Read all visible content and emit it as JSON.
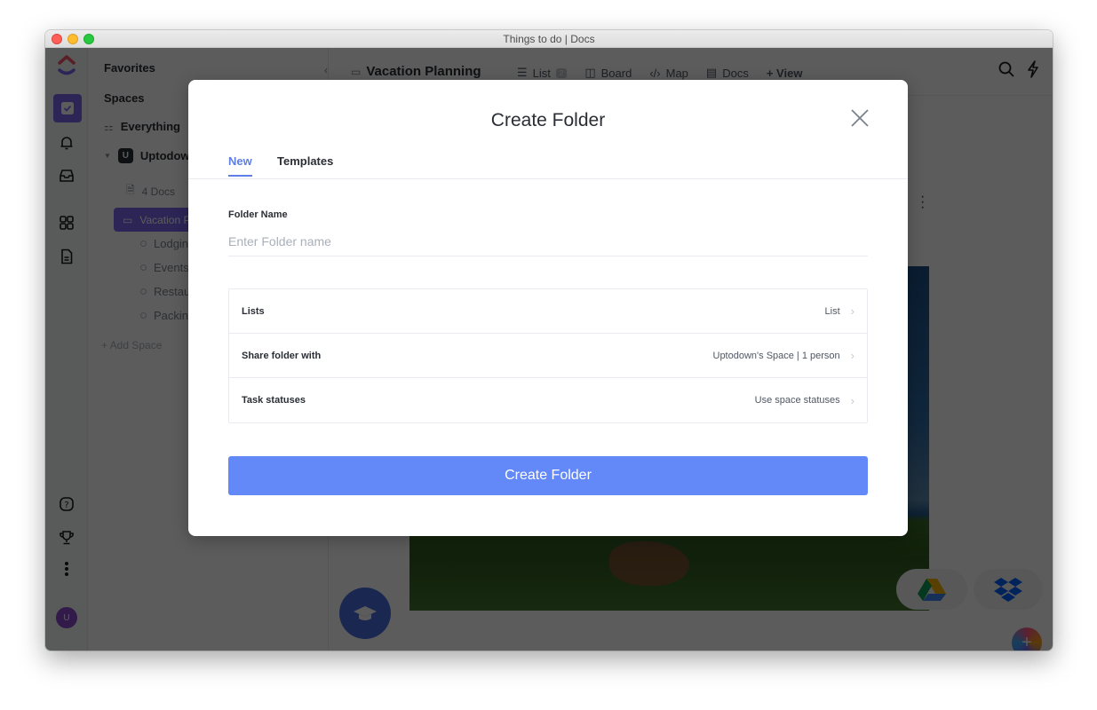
{
  "window": {
    "title": "Things to do | Docs"
  },
  "rail": {
    "icons": [
      "clickup-logo-icon",
      "tasks-icon",
      "notifications-bell-icon",
      "inbox-icon",
      "dashboards-icon",
      "docs-icon",
      "help-icon",
      "trophy-icon",
      "more-icon"
    ],
    "avatar_initial": "U"
  },
  "sidebar": {
    "favorites_label": "Favorites",
    "spaces_label": "Spaces",
    "everything_label": "Everything",
    "space": {
      "initial": "U",
      "name": "Uptodown's Space"
    },
    "docs_label": "4 Docs",
    "active_folder": "Vacation Planning",
    "lists": [
      "Lodging",
      "Events",
      "Restaurants",
      "Packing"
    ],
    "add_space_label": "+ Add Space"
  },
  "topbar": {
    "breadcrumb": "Vacation Planning",
    "views": [
      {
        "label": "List",
        "badge": "2"
      },
      {
        "label": "Board"
      },
      {
        "label": "Map"
      },
      {
        "label": "Docs"
      },
      {
        "label": "+ View"
      }
    ]
  },
  "modal": {
    "title": "Create Folder",
    "tabs": [
      {
        "label": "New",
        "active": true
      },
      {
        "label": "Templates",
        "active": false
      }
    ],
    "folder_name": {
      "label": "Folder Name",
      "value": "",
      "placeholder": "Enter Folder name"
    },
    "options": [
      {
        "label": "Lists",
        "value": "List"
      },
      {
        "label": "Share folder with",
        "value": "Uptodown's Space | 1 person"
      },
      {
        "label": "Task statuses",
        "value": "Use space statuses"
      }
    ],
    "submit_label": "Create Folder"
  },
  "colors": {
    "accent": "#6388f8",
    "tab_active": "#5f7fe8",
    "overlay": "rgba(0,0,0,0.64)"
  }
}
